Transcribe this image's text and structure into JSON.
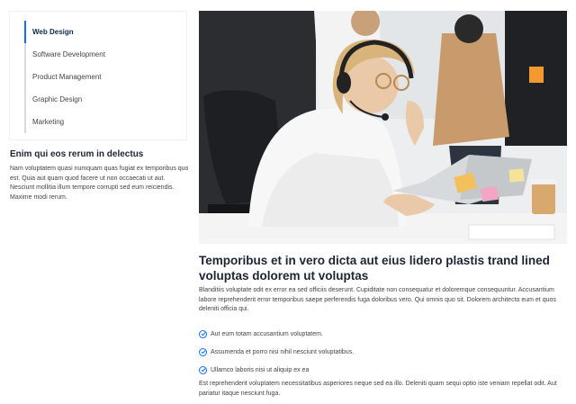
{
  "sidebar": {
    "items": [
      {
        "label": "Web Design"
      },
      {
        "label": "Software Development"
      },
      {
        "label": "Product Management"
      },
      {
        "label": "Graphic Design"
      },
      {
        "label": "Marketing"
      }
    ],
    "title": "Enim qui eos rerum in delectus",
    "text": "Nam voluptatem quasi numquam quas fugiat ex temporibus quo est. Quia aut quam quod facere ut non occaecati ut aut. Nesciunt mollitia illum tempore corrupti sed eum reiciendis. Maxime modi rerum."
  },
  "colors": {
    "accent": "#0d6efd",
    "heading": "#1c2434",
    "text": "#444444"
  },
  "main": {
    "image": "photo-woman-headset-laptop",
    "title": "Temporibus et in vero dicta aut eius lidero plastis trand lined voluptas dolorem ut voluptas",
    "text": "Blanditiis voluptate odit ex error ea sed officiis deserunt. Cupiditate non consequatur et doloremque consequuntur. Accusantium labore reprehenderit error temporibus saepe perferendis fuga doloribus vero. Qui omnis quo sit. Dolorem architecto eum et quos deleniti officia qui.",
    "checks": [
      {
        "label": "Aut eum totam accusantium voluptatem.",
        "icon": "check-circle-icon"
      },
      {
        "label": "Assumenda et porro nisi nihil nesciunt voluptatibus.",
        "icon": "check-circle-icon"
      },
      {
        "label": "Ullamco laboris nisi ut aliquip ex ea",
        "icon": "check-circle-icon"
      }
    ],
    "text2": "Est reprehenderit voluptatem necessitatibus asperiores neque sed ea illo. Deleniti quam sequi optio iste veniam repellat odit. Aut pariatur itaque nesciunt fuga."
  }
}
